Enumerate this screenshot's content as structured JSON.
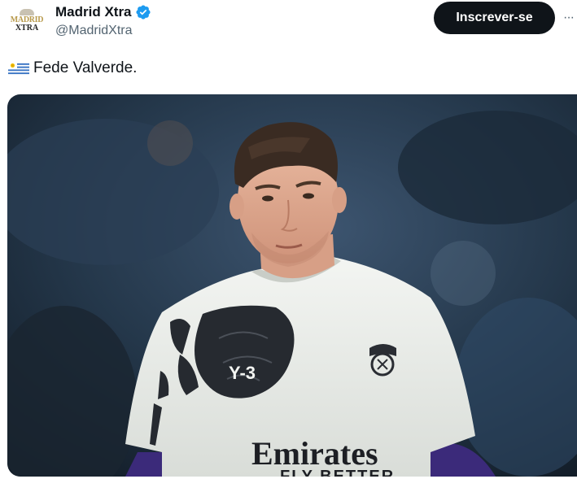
{
  "tweet": {
    "author": {
      "display_name": "Madrid Xtra",
      "handle": "@MadridXtra",
      "verified": true,
      "avatar_text_line1": "MADRID",
      "avatar_text_line2": "XTRA"
    },
    "subscribe_label": "Inscrever-se",
    "more_label": "···",
    "flag_icon": "uruguay-flag-icon",
    "text": "Fede Valverde.",
    "media": {
      "kind": "photo",
      "shirt_text_logo": "Y-3",
      "shirt_text_sponsor": "Emirates",
      "shirt_text_slogan": "FLY BETTER"
    }
  },
  "colors": {
    "text_primary": "#0f1419",
    "text_secondary": "#536471",
    "button_bg": "#0f1419",
    "verified_blue": "#1d9bf0"
  }
}
